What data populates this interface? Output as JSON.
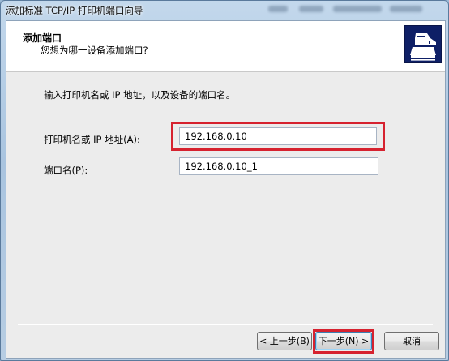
{
  "window": {
    "title": "添加标准 TCP/IP 打印机端口向导"
  },
  "header": {
    "title": "添加端口",
    "subtitle": "您想为哪一设备添加端口?",
    "logo_icon": "printer-icon"
  },
  "main": {
    "instruction": "输入打印机名或 IP 地址，以及设备的端口名。",
    "printer_field": {
      "label": "打印机名或 IP 地址(A):",
      "value": "192.168.0.10"
    },
    "port_field": {
      "label": "端口名(P):",
      "value": "192.168.0.10_1"
    }
  },
  "buttons": {
    "back": "< 上一步(B)",
    "next": "下一步(N) >",
    "cancel": "取消"
  },
  "colors": {
    "highlight": "#d6222f",
    "logo_bg": "#0e1f66"
  }
}
